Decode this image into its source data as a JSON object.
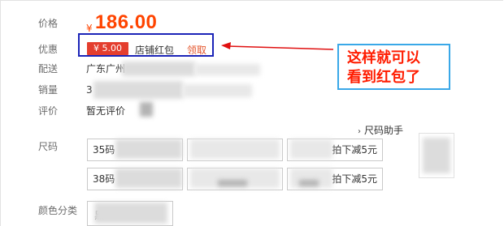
{
  "labels": {
    "price": "价格",
    "promo": "优惠",
    "delivery": "配送",
    "sales": "销量",
    "reviews": "评价",
    "size": "尺码",
    "color_category": "颜色分类"
  },
  "price": {
    "currency": "¥",
    "amount": "186.00"
  },
  "promo": {
    "coupon_value": "¥ 5.00",
    "coupon_type": "店铺红包",
    "claim_label": "领取"
  },
  "delivery": {
    "location": "广东广州"
  },
  "sales": {
    "value": "3"
  },
  "reviews": {
    "text": "暂无评价"
  },
  "callout": {
    "line1": "这样就可以",
    "line2": "看到红包了"
  },
  "size_chart": {
    "caret": "›",
    "label": "尺码助手"
  },
  "size_options": [
    {
      "left": "35码",
      "right": "拍下减5元"
    },
    {
      "left": "38码",
      "right": "拍下减5元"
    }
  ],
  "color_options": [
    {
      "left": "黑"
    }
  ],
  "colors": {
    "price": "#ff4400",
    "coupon_bg": "#e43e2e",
    "callout_text": "#ff1c00",
    "callout_border": "#3aa8e8",
    "highlight_box": "#1b24b8",
    "arrow": "#e01010"
  }
}
